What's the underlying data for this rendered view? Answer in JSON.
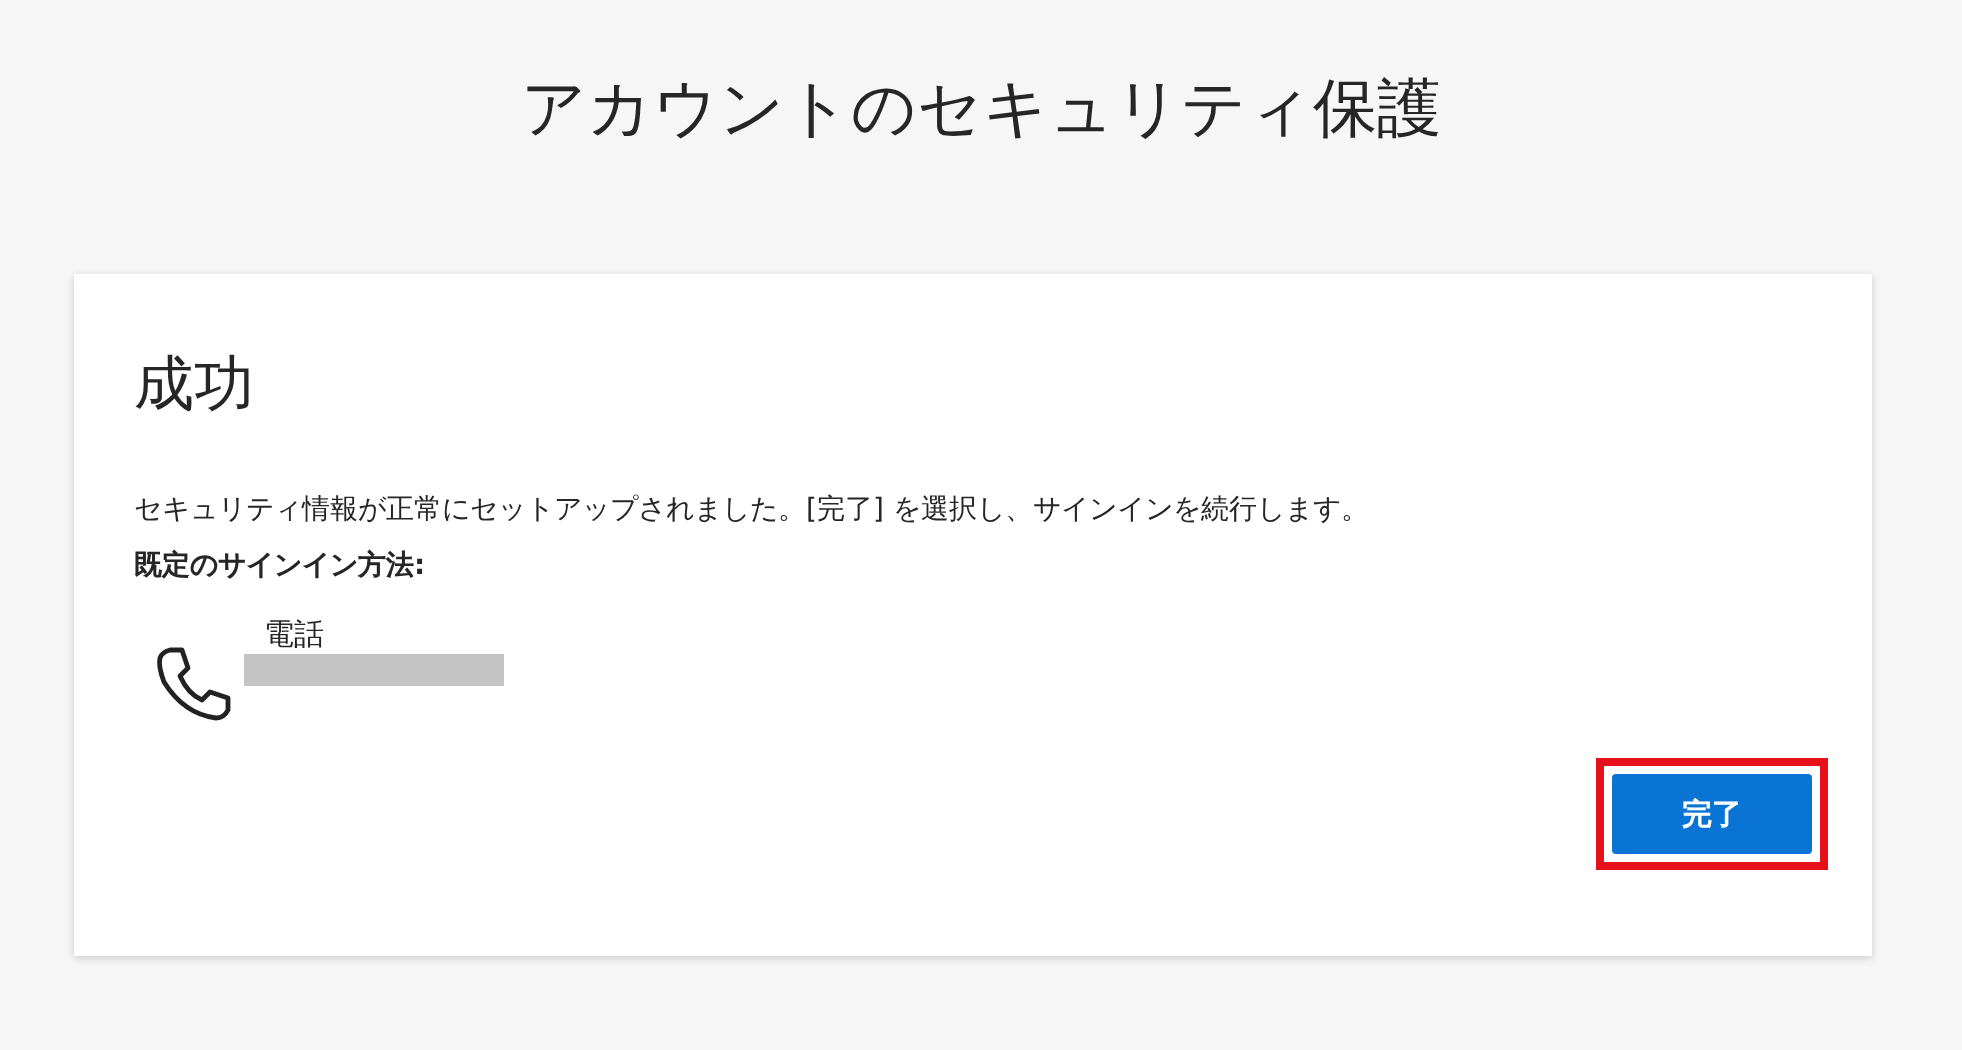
{
  "page_title": "アカウントのセキュリティ保護",
  "card": {
    "heading": "成功",
    "message": "セキュリティ情報が正常にセットアップされました。[完了] を選択し、サインインを続行します。",
    "default_method_label": "既定のサインイン方法:",
    "method": {
      "name": "電話",
      "redacted": true
    },
    "done_button": {
      "label": "完了",
      "highlighted": true
    }
  }
}
